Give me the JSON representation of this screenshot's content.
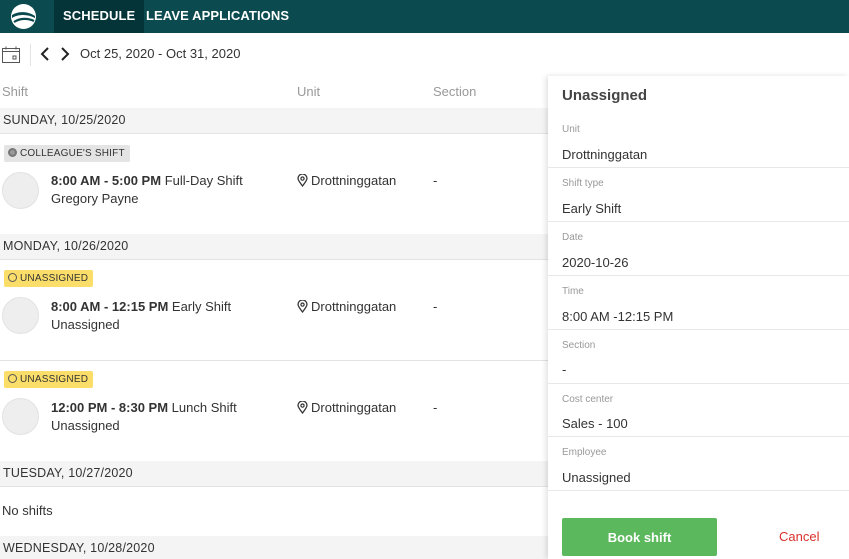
{
  "nav": {
    "tabs": [
      {
        "label": "SCHEDULE",
        "active": true
      },
      {
        "label": "LEAVE APPLICATIONS",
        "active": false
      }
    ]
  },
  "toolbar": {
    "date_range": "Oct 25, 2020 - Oct 31, 2020",
    "icons": [
      "calendar-icon",
      "chevron-left-icon",
      "chevron-right-icon"
    ]
  },
  "table": {
    "columns": [
      "Shift",
      "Unit",
      "Section"
    ],
    "days": [
      {
        "label": "SUNDAY, 10/25/2020",
        "shifts": [
          {
            "badge": "COLLEAGUE'S SHIFT",
            "badge_type": "colleague",
            "time": "8:00 AM - 5:00 PM",
            "type": "Full-Day Shift",
            "employee": "Gregory Payne",
            "unit": "Drottninggatan",
            "section": "-"
          }
        ]
      },
      {
        "label": "MONDAY, 10/26/2020",
        "shifts": [
          {
            "badge": "UNASSIGNED",
            "badge_type": "unassigned",
            "time": "8:00 AM - 12:15 PM",
            "type": "Early Shift",
            "employee": "Unassigned",
            "unit": "Drottninggatan",
            "section": "-"
          },
          {
            "badge": "UNASSIGNED",
            "badge_type": "unassigned",
            "time": "12:00 PM - 8:30 PM",
            "type": "Lunch Shift",
            "employee": "Unassigned",
            "unit": "Drottninggatan",
            "section": "-"
          }
        ]
      },
      {
        "label": "TUESDAY, 10/27/2020",
        "empty_text": "No shifts"
      },
      {
        "label": "WEDNESDAY, 10/28/2020"
      }
    ]
  },
  "panel": {
    "title": "Unassigned",
    "fields": [
      {
        "label": "Unit",
        "value": "Drottninggatan"
      },
      {
        "label": "Shift type",
        "value": "Early Shift"
      },
      {
        "label": "Date",
        "value": "2020-10-26"
      },
      {
        "label": "Time",
        "value": "8:00 AM -12:15 PM"
      },
      {
        "label": "Section",
        "value": "-"
      },
      {
        "label": "Cost center",
        "value": "Sales - 100"
      },
      {
        "label": "Employee",
        "value": "Unassigned"
      }
    ],
    "book_label": "Book shift",
    "cancel_label": "Cancel"
  },
  "colors": {
    "nav_bg": "#0b4a4e",
    "nav_active": "#043438",
    "badge_unassigned": "#fbde6a",
    "badge_colleague": "#e4e4e4",
    "book_button": "#5cb85c",
    "cancel_text": "#d9322b"
  }
}
